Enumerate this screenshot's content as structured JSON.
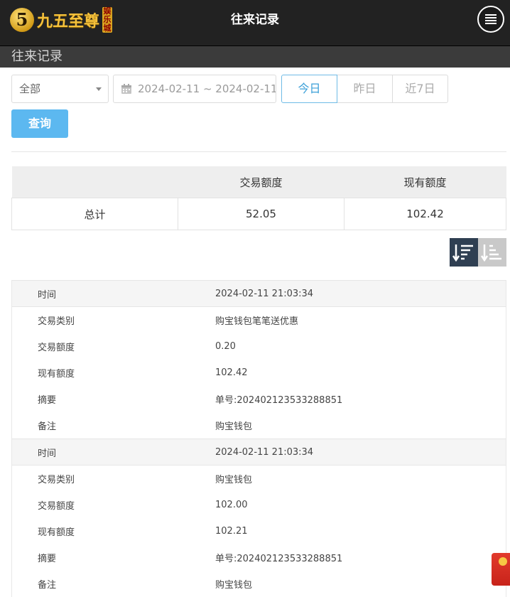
{
  "header": {
    "logo_mark": "5",
    "logo_text": "九五至尊",
    "logo_tag": [
      "娱",
      "乐",
      "城"
    ],
    "title": "往来记录"
  },
  "section": {
    "title": "往来记录"
  },
  "filters": {
    "type_select": "全部",
    "date_range": "2024-02-11 ~ 2024-02-11",
    "quick_ranges": [
      "今日",
      "昨日",
      "近7日"
    ],
    "active_quick_range": "今日",
    "query_button": "查询"
  },
  "summary": {
    "headers": [
      "",
      "交易额度",
      "现有额度"
    ],
    "row": {
      "label": "总计",
      "trade_amount": "52.05",
      "current_amount": "102.42"
    }
  },
  "records": [
    {
      "fields": [
        {
          "label": "时间",
          "value": "2024-02-11 21:03:34"
        },
        {
          "label": "交易类别",
          "value": "购宝钱包笔笔送优惠"
        },
        {
          "label": "交易额度",
          "value": "0.20"
        },
        {
          "label": "现有额度",
          "value": "102.42"
        },
        {
          "label": "摘要",
          "value": "单号:202402123533288851"
        },
        {
          "label": "备注",
          "value": "购宝钱包"
        }
      ]
    },
    {
      "fields": [
        {
          "label": "时间",
          "value": "2024-02-11 21:03:34"
        },
        {
          "label": "交易类别",
          "value": "购宝钱包"
        },
        {
          "label": "交易额度",
          "value": "102.00"
        },
        {
          "label": "现有额度",
          "value": "102.21"
        },
        {
          "label": "摘要",
          "value": "单号:202402123533288851"
        },
        {
          "label": "备注",
          "value": "购宝钱包"
        }
      ]
    }
  ],
  "colors": {
    "header_bg": "#222222",
    "section_bg": "#3b3b3b",
    "accent_blue": "#5cb8f0",
    "sort_active": "#2f3f52"
  }
}
